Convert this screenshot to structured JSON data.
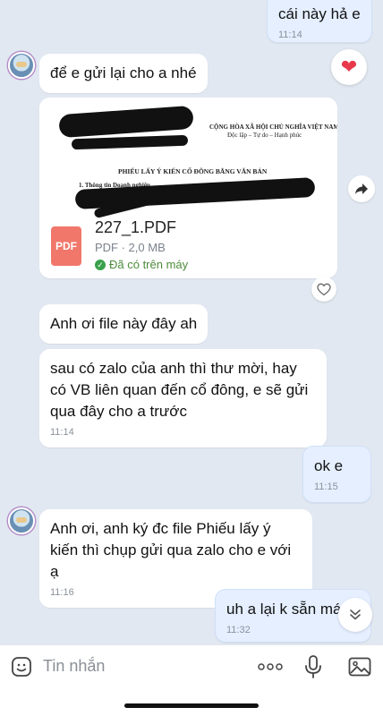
{
  "messages": {
    "m1": {
      "text": "cái này hả e",
      "time": "11:14"
    },
    "m2": {
      "text": "để e gửi lại cho a nhé"
    },
    "file": {
      "name": "227_1.PDF",
      "meta": "PDF · 2,0 MB",
      "status": "Đã có trên máy",
      "icon_label": "PDF",
      "doc_header": "CỘNG HÒA XÃ HỘI CHỦ NGHĨA VIỆT NAM",
      "doc_subheader": "Độc lập – Tự do – Hạnh phúc",
      "doc_title": "PHIẾU LẤY Ý KIẾN CỔ ĐÔNG BẰNG VĂN BẢN",
      "doc_section": "1.   Thông tin Doanh nghiệp"
    },
    "m3": {
      "text": "Anh ơi file này đây ah"
    },
    "m4": {
      "text": "sau có zalo của anh thì thư mời, hay có VB liên quan đến cổ đông, e sẽ gửi qua đây cho a trước",
      "time": "11:14"
    },
    "m5": {
      "text": "ok e",
      "time": "11:15"
    },
    "m6": {
      "text": "Anh ơi, anh ký đc file Phiếu lấy ý kiến thì chụp gửi qua zalo cho e với ạ",
      "time": "11:16"
    },
    "m7": {
      "text": "uh a lại k sẵn máy",
      "time": "11:32"
    }
  },
  "composer": {
    "placeholder": "Tin nhắn"
  },
  "icons": {
    "reaction": "heart-icon",
    "share": "share-arrow-icon",
    "like": "heart-outline-icon",
    "scroll": "chevron-double-down-icon",
    "emoji": "sticker-icon",
    "more": "more-dots-icon",
    "mic": "microphone-icon",
    "image": "image-icon"
  },
  "colors": {
    "background": "#e2e8f1",
    "my_bubble": "#e5efff",
    "reaction_heart": "#e8394b",
    "pdf_icon": "#f0776a",
    "downloaded_status": "#4d8b3c"
  }
}
